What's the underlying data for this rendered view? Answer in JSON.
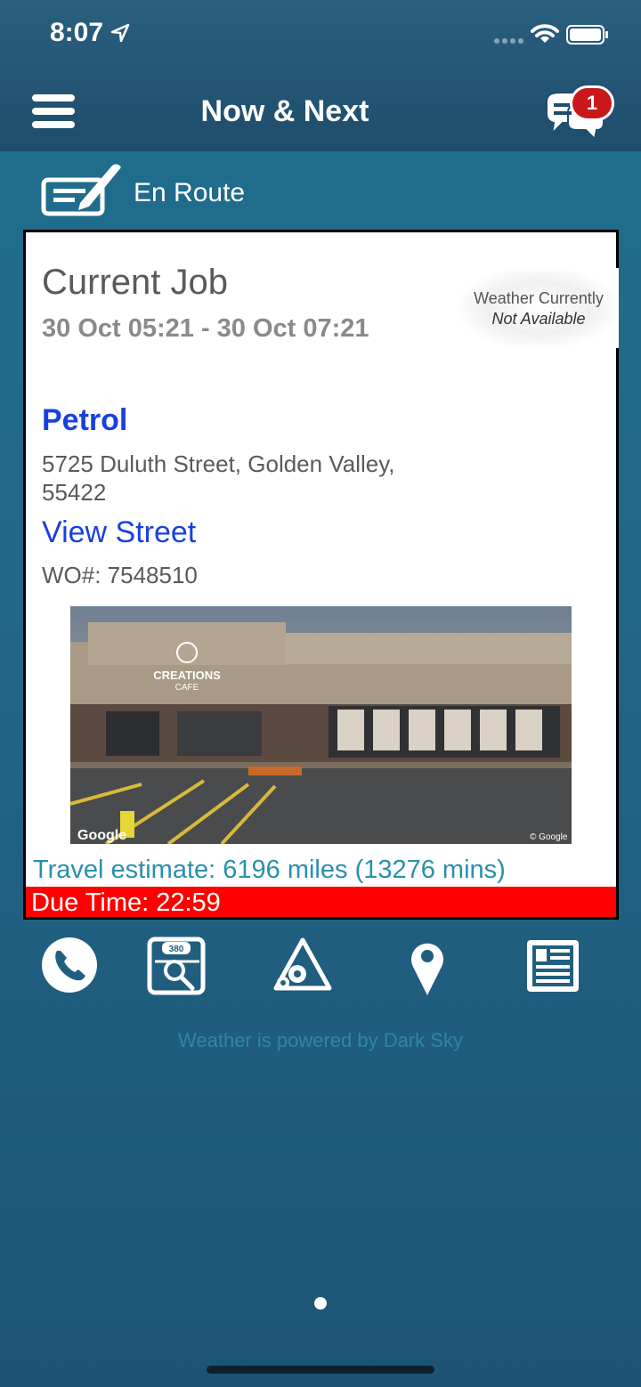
{
  "status_bar": {
    "time": "8:07"
  },
  "nav": {
    "title": "Now & Next",
    "badge_count": "1"
  },
  "job_status": {
    "label": "En Route"
  },
  "current_job": {
    "title": "Current Job",
    "time_range": "30 Oct 05:21 - 30 Oct 07:21",
    "weather_line1": "Weather Currently",
    "weather_line2": "Not Available",
    "site_name": "Petrol",
    "address": "5725 Duluth Street, Golden Valley, 55422",
    "view_street_label": "View Street",
    "work_order": "WO#: 7548510",
    "photo": {
      "storefront_sign_1": "CREATIONS",
      "storefront_sign_2": "CAFE",
      "watermark_left": "Google",
      "watermark_right": "© Google"
    },
    "travel_estimate": "Travel estimate: 6196 miles (13276 mins)",
    "due_time": "Due Time: 22:59"
  },
  "actions": [
    {
      "icon": "phone-icon"
    },
    {
      "icon": "map-search-icon"
    },
    {
      "icon": "settings-triangle-icon"
    },
    {
      "icon": "location-pin-icon"
    },
    {
      "icon": "notes-icon"
    }
  ],
  "footer": {
    "powered_by": "Weather is powered by Dark Sky"
  },
  "colors": {
    "accent_blue": "#1a3fe0",
    "due_red": "#ff0000",
    "travel_teal": "#2a8fae"
  }
}
